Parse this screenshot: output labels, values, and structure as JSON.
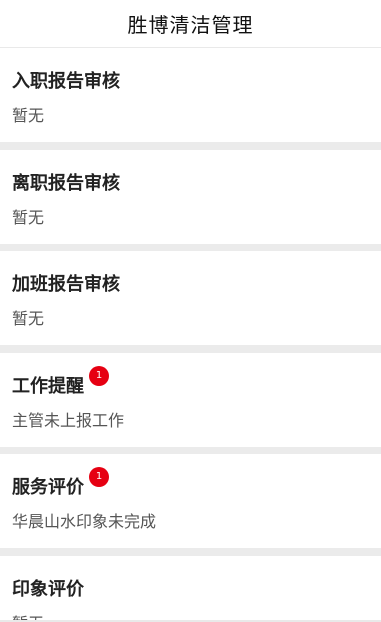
{
  "header": {
    "title": "胜博清洁管理"
  },
  "cards": [
    {
      "title": "入职报告审核",
      "subtitle": "暂无"
    },
    {
      "title": "离职报告审核",
      "subtitle": "暂无"
    },
    {
      "title": "加班报告审核",
      "subtitle": "暂无"
    },
    {
      "title": "工作提醒",
      "badge": "1",
      "subtitle": "主管未上报工作"
    },
    {
      "title": "服务评价",
      "badge": "1",
      "subtitle": "华晨山水印象未完成"
    },
    {
      "title": "印象评价",
      "subtitle": "暂无"
    }
  ],
  "colors": {
    "badge": "#e60012",
    "separator": "#ebebeb"
  }
}
